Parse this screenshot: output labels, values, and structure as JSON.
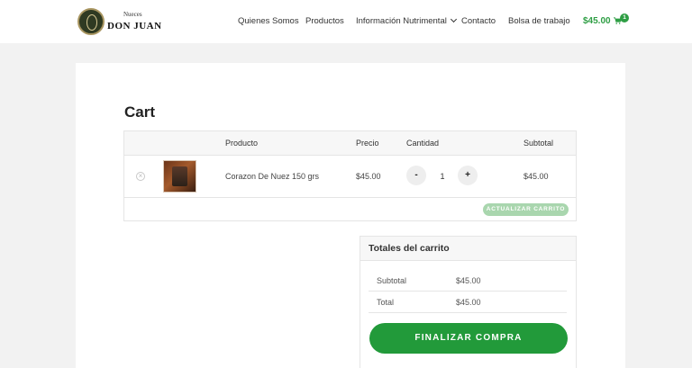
{
  "header": {
    "logo_small": "Nueces",
    "logo_big": "DON JUAN",
    "nav": [
      "Quienes Somos",
      "Productos",
      "Información Nutrimental",
      "Contacto",
      "Bolsa de trabajo"
    ],
    "cart_total": "$45.00",
    "cart_count": "1"
  },
  "colors": {
    "accent": "#229a3a",
    "accent_light": "#a9d6ae"
  },
  "page_title": "Cart",
  "table": {
    "headers": [
      "Producto",
      "Precio",
      "Cantidad",
      "Subtotal"
    ],
    "rows": [
      {
        "product": "Corazon De Nuez 150 grs",
        "price": "$45.00",
        "quantity": "1",
        "subtotal": "$45.00",
        "remove_icon": "x-circle-icon",
        "minus": "-",
        "plus": "+"
      }
    ],
    "update_button": "ACTUALIZAR CARRITO"
  },
  "totals": {
    "title": "Totales del carrito",
    "subtotal_label": "Subtotal",
    "subtotal_value": "$45.00",
    "total_label": "Total",
    "total_value": "$45.00",
    "checkout_button": "FINALIZAR COMPRA"
  }
}
